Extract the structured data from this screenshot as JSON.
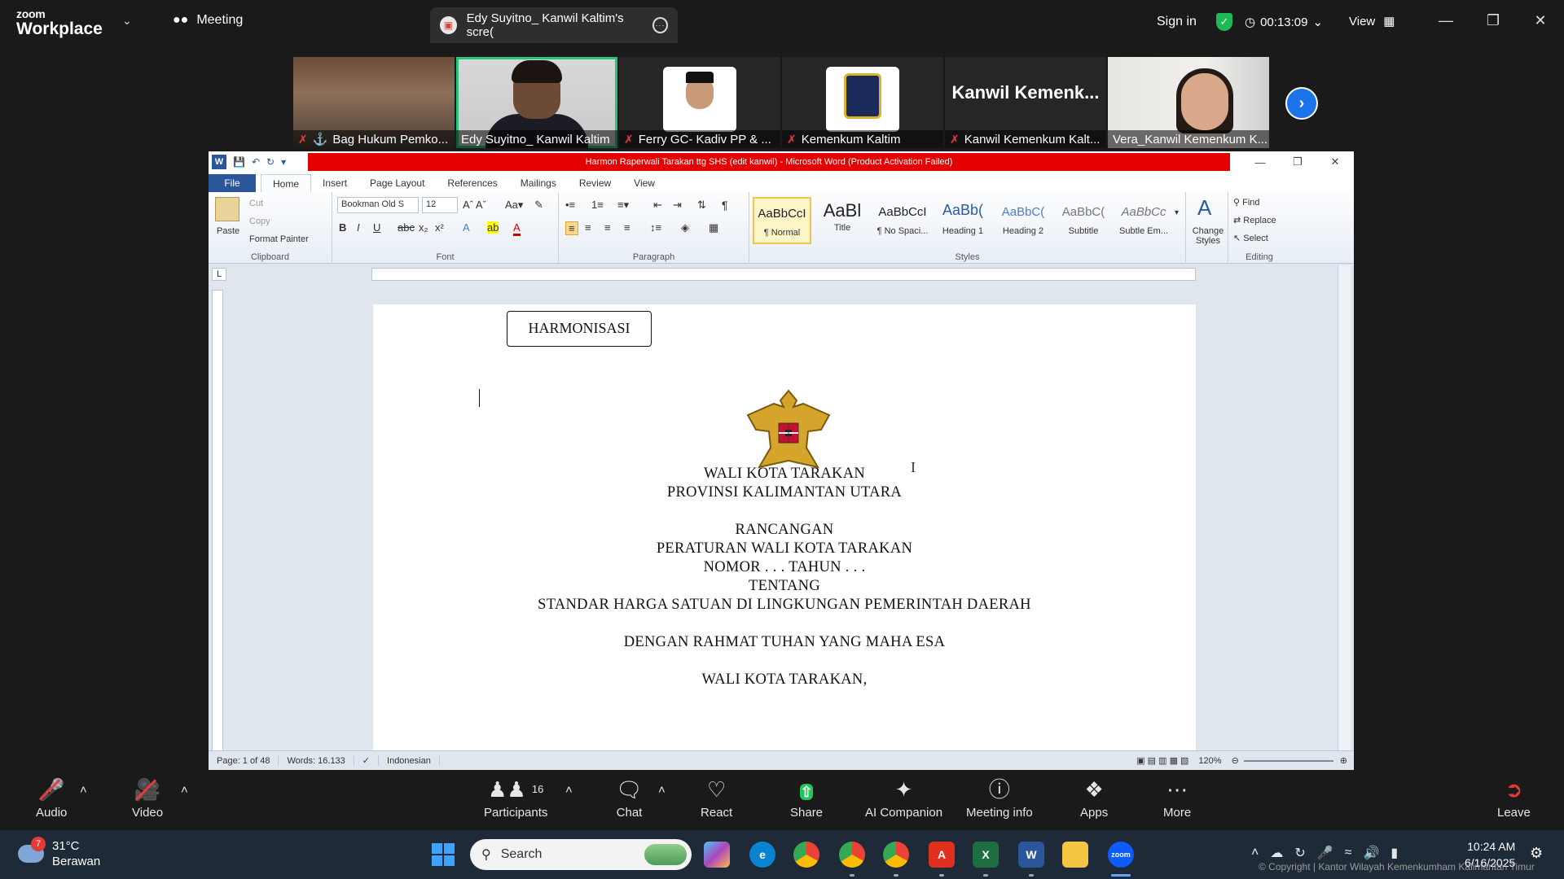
{
  "zoom": {
    "logo_line1": "zoom",
    "logo_line2": "Workplace",
    "meeting_tab": "Meeting",
    "share_tab": "Edy Suyitno_ Kanwil Kaltim's scre(",
    "sign_in": "Sign in",
    "timer": "00:13:09",
    "view": "View"
  },
  "participants": [
    {
      "name": "Bag Hukum Pemko..."
    },
    {
      "name": "Edy Suyitno_ Kanwil Kaltim"
    },
    {
      "name": "Ferry GC- Kadiv PP & ..."
    },
    {
      "name": "Kemenkum Kaltim"
    },
    {
      "name": "Kanwil Kemenkum Kalt...",
      "big": "Kanwil  Kemenk..."
    },
    {
      "name": "Vera_Kanwil Kemenkum K..."
    }
  ],
  "word": {
    "title": "Harmon Raperwali Tarakan ttg SHS (edit kanwil) - Microsoft Word (Product Activation Failed)",
    "tabs": [
      "File",
      "Home",
      "Insert",
      "Page Layout",
      "References",
      "Mailings",
      "Review",
      "View"
    ],
    "clipboard": {
      "paste": "Paste",
      "cut": "Cut",
      "copy": "Copy",
      "format_painter": "Format Painter",
      "label": "Clipboard"
    },
    "font": {
      "name": "Bookman Old S",
      "size": "12",
      "label": "Font"
    },
    "paragraph_label": "Paragraph",
    "styles": [
      {
        "preview": "AaBbCcI",
        "label": "¶ Normal"
      },
      {
        "preview": "AaBl",
        "label": "Title"
      },
      {
        "preview": "AaBbCcI",
        "label": "¶ No Spaci..."
      },
      {
        "preview": "AaBb(",
        "label": "Heading 1"
      },
      {
        "preview": "AaBbC(",
        "label": "Heading 2"
      },
      {
        "preview": "AaBbC(",
        "label": "Subtitle"
      },
      {
        "preview": "AaBbCc",
        "label": "Subtle Em..."
      }
    ],
    "styles_label": "Styles",
    "change_styles": "Change Styles",
    "editing": {
      "find": "Find",
      "replace": "Replace",
      "select": "Select",
      "label": "Editing"
    },
    "document": {
      "box_label": "HARMONISASI",
      "lines": [
        "WALI KOTA TARAKAN",
        "PROVINSI KALIMANTAN UTARA",
        "RANCANGAN",
        "PERATURAN WALI KOTA TARAKAN",
        "NOMOR . . . TAHUN . . .",
        "TENTANG",
        "STANDAR HARGA SATUAN DI LINGKUNGAN PEMERINTAH DAERAH",
        "DENGAN RAHMAT TUHAN YANG MAHA ESA",
        "WALI KOTA TARAKAN,"
      ]
    },
    "status": {
      "page": "Page: 1 of 48",
      "words": "Words: 16.133",
      "language": "Indonesian",
      "zoom": "120%"
    }
  },
  "toolbar": {
    "audio": "Audio",
    "video": "Video",
    "participants": "Participants",
    "participants_count": "16",
    "chat": "Chat",
    "react": "React",
    "share": "Share",
    "ai_companion": "AI Companion",
    "meeting_info": "Meeting info",
    "apps": "Apps",
    "more": "More",
    "leave": "Leave"
  },
  "taskbar": {
    "temperature": "31°C",
    "condition": "Berawan",
    "weather_badge": "7",
    "search_placeholder": "Search",
    "time": "10:24 AM",
    "date": "6/16/2025",
    "copyright": "© Copyright | Kantor Wilayah Kemenkumham Kalimantan Timur"
  },
  "colors": {
    "accent_green": "#27c47a",
    "zoom_blue": "#1a73e8",
    "word_blue": "#2b579a",
    "activation_red": "#e40000"
  }
}
